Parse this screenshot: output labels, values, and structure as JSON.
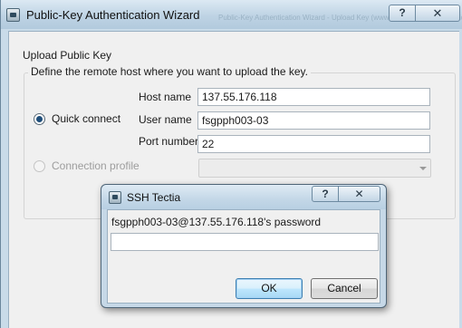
{
  "wizard": {
    "title": "Public-Key Authentication Wizard",
    "ghost_title": "Public-Key Authentication Wizard - Upload Key (www.ssh.com/key_authentication)",
    "help_button": "?",
    "close_button": "✕",
    "section_title": "Upload Public Key",
    "group_label": "Define the remote host where you want to upload the key.",
    "quick_connect": {
      "label": "Quick connect",
      "selected": true
    },
    "host_name": {
      "label": "Host name",
      "value": "137.55.176.118"
    },
    "user_name": {
      "label": "User name",
      "value": "fsgpph003-03"
    },
    "port_number": {
      "label": "Port number",
      "value": "22"
    },
    "connection_profile": {
      "label": "Connection profile",
      "selected": false,
      "value": ""
    }
  },
  "password_dialog": {
    "title": "SSH Tectia",
    "help_button": "?",
    "close_button": "✕",
    "prompt": "fsgpph003-03@137.55.176.118's password",
    "password_value": "",
    "ok_label": "OK",
    "cancel_label": "Cancel"
  },
  "icons": {
    "wizard_app_icon": "ssh-tectia-icon",
    "dialog_app_icon": "ssh-tectia-icon"
  },
  "colors": {
    "title_bar": "#bed3e4",
    "client_bg": "#f0f0f0",
    "default_button_border": "#3c7fb1"
  }
}
